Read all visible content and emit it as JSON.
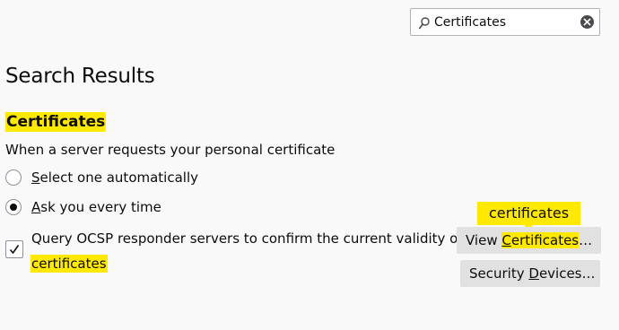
{
  "search": {
    "value": "Certificates"
  },
  "page_title": "Search Results",
  "section": {
    "heading": "Certificates",
    "description": "When a server requests your personal certificate",
    "radio_options": [
      {
        "first": "S",
        "rest": "elect one automatically",
        "checked": false
      },
      {
        "first": "A",
        "rest": "sk you every time",
        "checked": true
      }
    ],
    "ocsp": {
      "line1": "Query OCSP responder servers to confirm the current validity of",
      "line2": "certificates",
      "checked": true
    },
    "buttons": {
      "view_pre": "View ",
      "view_key": "C",
      "view_hl": "ertificates",
      "view_post": "…",
      "devices_pre": "Security ",
      "devices_key": "D",
      "devices_rest": "evices…"
    },
    "tooltip": "certificates"
  },
  "colors": {
    "highlight": "#ffe900",
    "background": "#f9f9fa",
    "button": "#e1e1e2"
  },
  "icons": {
    "search": "search-icon",
    "clear": "clear-icon",
    "check": "check-icon"
  }
}
